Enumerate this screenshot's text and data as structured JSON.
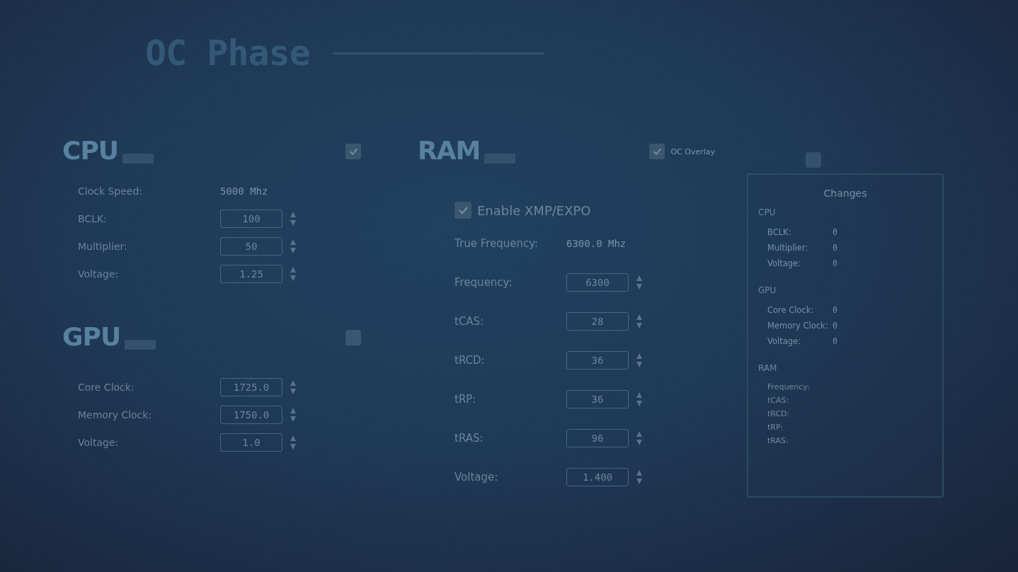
{
  "title": "OC Phase",
  "cpu": {
    "heading": "CPU",
    "overlay_checked": true,
    "rows": [
      {
        "kind": "readout",
        "label": "Clock Speed:",
        "value": "5000 Mhz"
      },
      {
        "kind": "spinner",
        "label": "BCLK:",
        "value": "100"
      },
      {
        "kind": "spinner",
        "label": "Multiplier:",
        "value": "50"
      },
      {
        "kind": "spinner",
        "label": "Voltage:",
        "value": "1.25"
      }
    ]
  },
  "gpu": {
    "heading": "GPU",
    "overlay_checked": false,
    "rows": [
      {
        "kind": "spinner",
        "label": "Core Clock:",
        "value": "1725.0"
      },
      {
        "kind": "spinner",
        "label": "Memory Clock:",
        "value": "1750.0"
      },
      {
        "kind": "spinner",
        "label": "Voltage:",
        "value": "1.0"
      }
    ]
  },
  "ram": {
    "heading": "RAM",
    "overlay_label": "OC Overlay",
    "overlay_checked": true,
    "xmp": {
      "label": "Enable XMP/EXPO",
      "checked": true
    },
    "rows": [
      {
        "kind": "readout",
        "label": "True Frequency:",
        "value": "6300.0 Mhz"
      },
      {
        "kind": "spinner",
        "label": "Frequency:",
        "value": "6300"
      },
      {
        "kind": "spinner",
        "label": "tCAS:",
        "value": "28"
      },
      {
        "kind": "spinner",
        "label": "tRCD:",
        "value": "36"
      },
      {
        "kind": "spinner",
        "label": "tRP:",
        "value": "36"
      },
      {
        "kind": "spinner",
        "label": "tRAS:",
        "value": "96"
      },
      {
        "kind": "spinner",
        "label": "Voltage:",
        "value": "1.400"
      }
    ]
  },
  "side_toggle": {
    "checked": false
  },
  "changes": {
    "title": "Changes",
    "groups": [
      {
        "name": "CPU",
        "items": [
          {
            "label": "BCLK:",
            "value": "0"
          },
          {
            "label": "Multiplier:",
            "value": "0"
          },
          {
            "label": "Voltage:",
            "value": "0"
          }
        ]
      },
      {
        "name": "GPU",
        "items": [
          {
            "label": "Core Clock:",
            "value": "0"
          },
          {
            "label": "Memory Clock:",
            "value": "0"
          },
          {
            "label": "Voltage:",
            "value": "0"
          }
        ]
      },
      {
        "name": "RAM",
        "items": [
          {
            "label": "Frequency:"
          },
          {
            "label": "tCAS:"
          },
          {
            "label": "tRCD:"
          },
          {
            "label": "tRP:"
          },
          {
            "label": "tRAS:"
          }
        ]
      }
    ]
  }
}
